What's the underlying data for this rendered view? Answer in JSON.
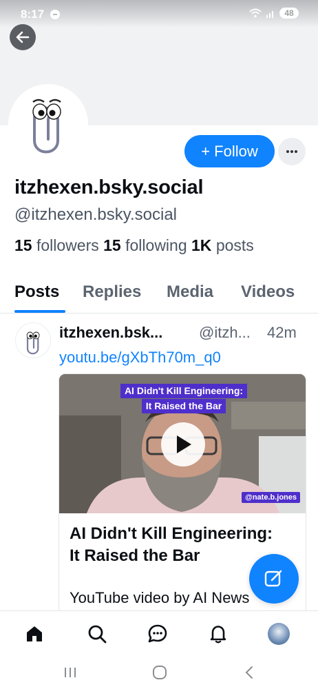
{
  "status_bar": {
    "time": "8:17",
    "battery": "48"
  },
  "profile": {
    "follow_label": "Follow",
    "display_name": "itzhexen.bsky.social",
    "handle": "@itzhexen.bsky.social",
    "stats": {
      "followers_count": "15",
      "followers_label": "followers",
      "following_count": "15",
      "following_label": "following",
      "posts_count": "1K",
      "posts_label": "posts"
    }
  },
  "tabs": [
    {
      "label": "Posts",
      "active": true
    },
    {
      "label": "Replies",
      "active": false
    },
    {
      "label": "Media",
      "active": false
    },
    {
      "label": "Videos",
      "active": false
    }
  ],
  "post": {
    "author": "itzhexen.bsk...",
    "handle": "@itzh...",
    "time": "42m",
    "link_text": "youtu.be/gXbTh70m_q0",
    "embed": {
      "thumbnail_title_line1": "AI Didn't Kill Engineering:",
      "thumbnail_title_line2": "It Raised the Bar",
      "thumbnail_tag": "@nate.b.jones",
      "title": "AI Didn't Kill Engineering: It Raised the Bar",
      "description": "YouTube video by AI News"
    }
  },
  "icons": {
    "back": "arrow-left-icon",
    "more": "ellipsis-icon",
    "play": "play-icon",
    "compose": "compose-icon",
    "nav": [
      "home-icon",
      "search-icon",
      "chat-icon",
      "bell-icon",
      "profile-avatar"
    ]
  },
  "colors": {
    "accent": "#1083fe",
    "thumb_tag": "#4f2fcb"
  }
}
